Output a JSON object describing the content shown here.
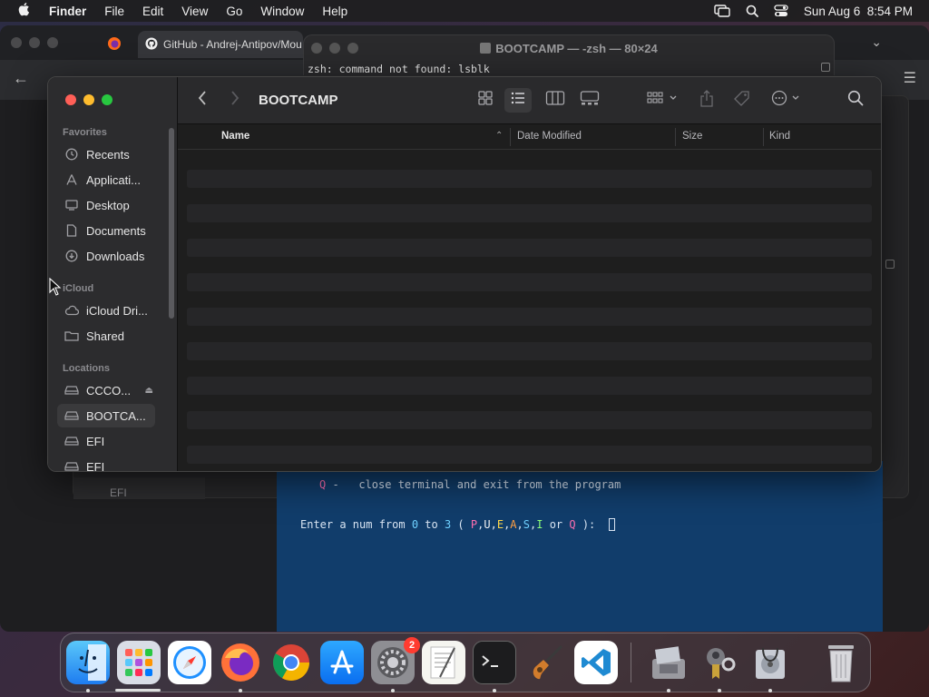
{
  "menubar": {
    "app_name": "Finder",
    "items": [
      "File",
      "Edit",
      "View",
      "Go",
      "Window",
      "Help"
    ],
    "datetime": "Sun Aug 6  8:54 PM"
  },
  "browser": {
    "tab_label": "GitHub - Andrej-Antipov/Mou"
  },
  "ghost": {
    "efi_label": "EFI"
  },
  "terminal": {
    "title": "BOOTCAMP — -zsh — 80×24",
    "output_line": "zsh: command not found: lsblk",
    "body": {
      "line1_key": "Q",
      "line1_text": " -   close terminal and exit from the program",
      "prompt_pre": "Enter a num from ",
      "prompt_from": "0",
      "prompt_to_word": " to ",
      "prompt_to": "3",
      "prompt_open": " ( ",
      "opt_p": "P",
      "opt_u": "U",
      "opt_e": "E",
      "opt_a": "A",
      "opt_s": "S",
      "opt_i": "I",
      "prompt_or": " or ",
      "opt_q": "Q",
      "prompt_close": " ):  "
    }
  },
  "finder": {
    "title": "BOOTCAMP",
    "sidebar": {
      "favorites_heading": "Favorites",
      "favorites": [
        "Recents",
        "Applicati...",
        "Desktop",
        "Documents",
        "Downloads"
      ],
      "icloud_heading": "iCloud",
      "icloud": [
        "iCloud Dri...",
        "Shared"
      ],
      "locations_heading": "Locations",
      "locations": [
        "CCCO...",
        "BOOTCA...",
        "EFI",
        "EFI"
      ]
    },
    "columns": {
      "name": "Name",
      "date_modified": "Date Modified",
      "size": "Size",
      "kind": "Kind"
    }
  },
  "dock": {
    "apps": [
      "Finder",
      "Launchpad",
      "Safari",
      "Firefox",
      "Chrome",
      "App Store",
      "System Settings",
      "TextEdit",
      "Terminal",
      "GarageBand",
      "Visual Studio Code",
      "Boot Camp Assistant",
      "Keychain Access",
      "Disk Utility",
      "Trash"
    ],
    "settings_badge": "2"
  },
  "colors": {
    "menubar_bg": "#1e1e20",
    "finder_sidebar": "#2c2c2e",
    "terminal_body": "#113d6b",
    "traffic_red": "#ff5f57",
    "traffic_yellow": "#febc2e",
    "traffic_green": "#28c840"
  }
}
